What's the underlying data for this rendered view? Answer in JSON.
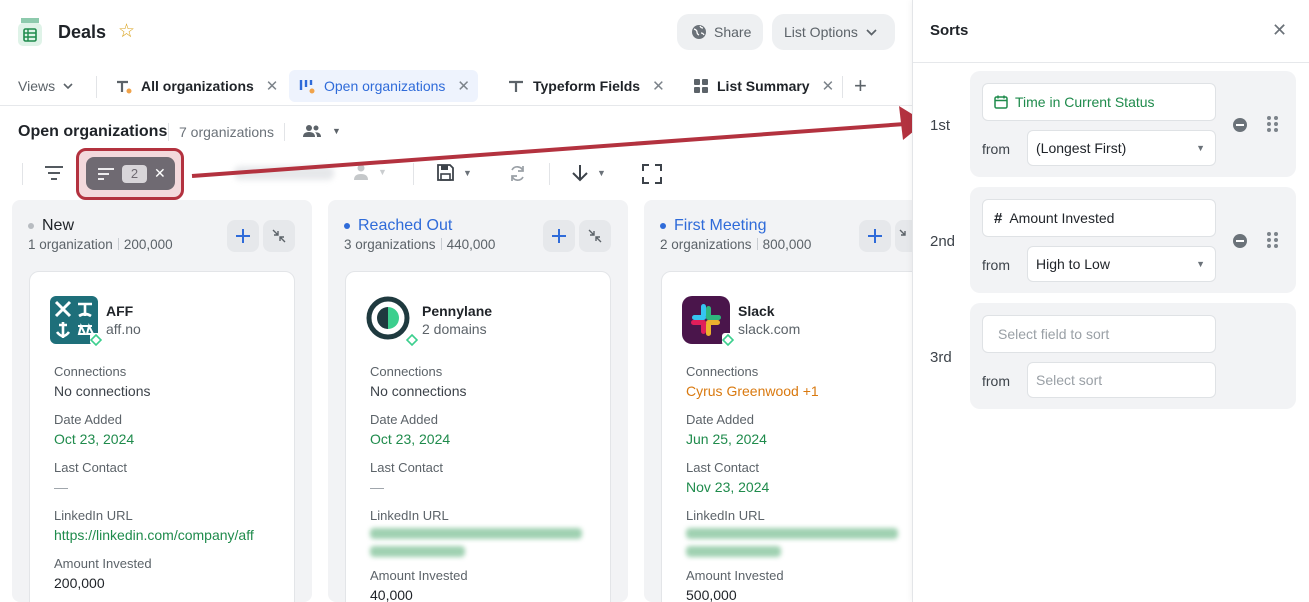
{
  "header": {
    "title": "Deals",
    "share_label": "Share",
    "list_options_label": "List Options"
  },
  "views": {
    "label": "Views",
    "tabs": [
      {
        "label": "All organizations",
        "active": false
      },
      {
        "label": "Open organizations",
        "active": true
      },
      {
        "label": "Typeform Fields",
        "active": false
      },
      {
        "label": "List Summary",
        "active": false
      }
    ]
  },
  "list": {
    "title": "Open organizations",
    "count": "7 organizations"
  },
  "toolbar": {
    "sort_count": "2"
  },
  "columns": [
    {
      "name": "New",
      "dot_color": "#b8bcc1",
      "name_color": "#1f2328",
      "count": "1 organization",
      "amount": "200,000",
      "card": {
        "name": "AFF",
        "sub": "aff.no",
        "fields": [
          {
            "label": "Connections",
            "value": "No connections",
            "style": "plain"
          },
          {
            "label": "Date Added",
            "value": "Oct 23, 2024",
            "style": "green"
          },
          {
            "label": "Last Contact",
            "value": "—",
            "style": "dash"
          },
          {
            "label": "LinkedIn URL",
            "value": "https://linkedin.com/company/aff",
            "style": "green"
          },
          {
            "label": "Amount Invested",
            "value": "200,000",
            "style": "dark"
          }
        ]
      }
    },
    {
      "name": "Reached Out",
      "dot_color": "#2f6bd9",
      "name_color": "#2f6bd9",
      "count": "3 organizations",
      "amount": "440,000",
      "card": {
        "name": "Pennylane",
        "sub": "2 domains",
        "fields": [
          {
            "label": "Connections",
            "value": "No connections",
            "style": "plain"
          },
          {
            "label": "Date Added",
            "value": "Oct 23, 2024",
            "style": "green"
          },
          {
            "label": "Last Contact",
            "value": "—",
            "style": "dash"
          },
          {
            "label": "LinkedIn URL",
            "value": "",
            "style": "blur"
          },
          {
            "label": "Amount Invested",
            "value": "40,000",
            "style": "dark"
          }
        ]
      }
    },
    {
      "name": "First Meeting",
      "dot_color": "#2f6bd9",
      "name_color": "#2f6bd9",
      "count": "2 organizations",
      "amount": "800,000",
      "card": {
        "name": "Slack",
        "sub": "slack.com",
        "fields": [
          {
            "label": "Connections",
            "value": "Cyrus Greenwood +1",
            "style": "orange"
          },
          {
            "label": "Date Added",
            "value": "Jun 25, 2024",
            "style": "green"
          },
          {
            "label": "Last Contact",
            "value": "Nov 23, 2024",
            "style": "green"
          },
          {
            "label": "LinkedIn URL",
            "value": "",
            "style": "blur"
          },
          {
            "label": "Amount Invested",
            "value": "500,000",
            "style": "dark"
          }
        ]
      }
    }
  ],
  "sorts_panel": {
    "title": "Sorts",
    "from_label": "from",
    "rules": [
      {
        "rank": "1st",
        "field": "Time in Current Status",
        "field_icon": "calendar-icon",
        "direction": "(Longest First)",
        "filled": true
      },
      {
        "rank": "2nd",
        "field": "Amount Invested",
        "field_icon": "hash-icon",
        "direction": "High to Low",
        "filled": true
      },
      {
        "rank": "3rd",
        "field_placeholder": "Select field to sort",
        "direction_placeholder": "Select sort",
        "filled": false
      }
    ]
  },
  "colors": {
    "accent_blue": "#2f6bd9",
    "green_value": "#1f8b4c",
    "annotation_red": "#b3323f"
  }
}
